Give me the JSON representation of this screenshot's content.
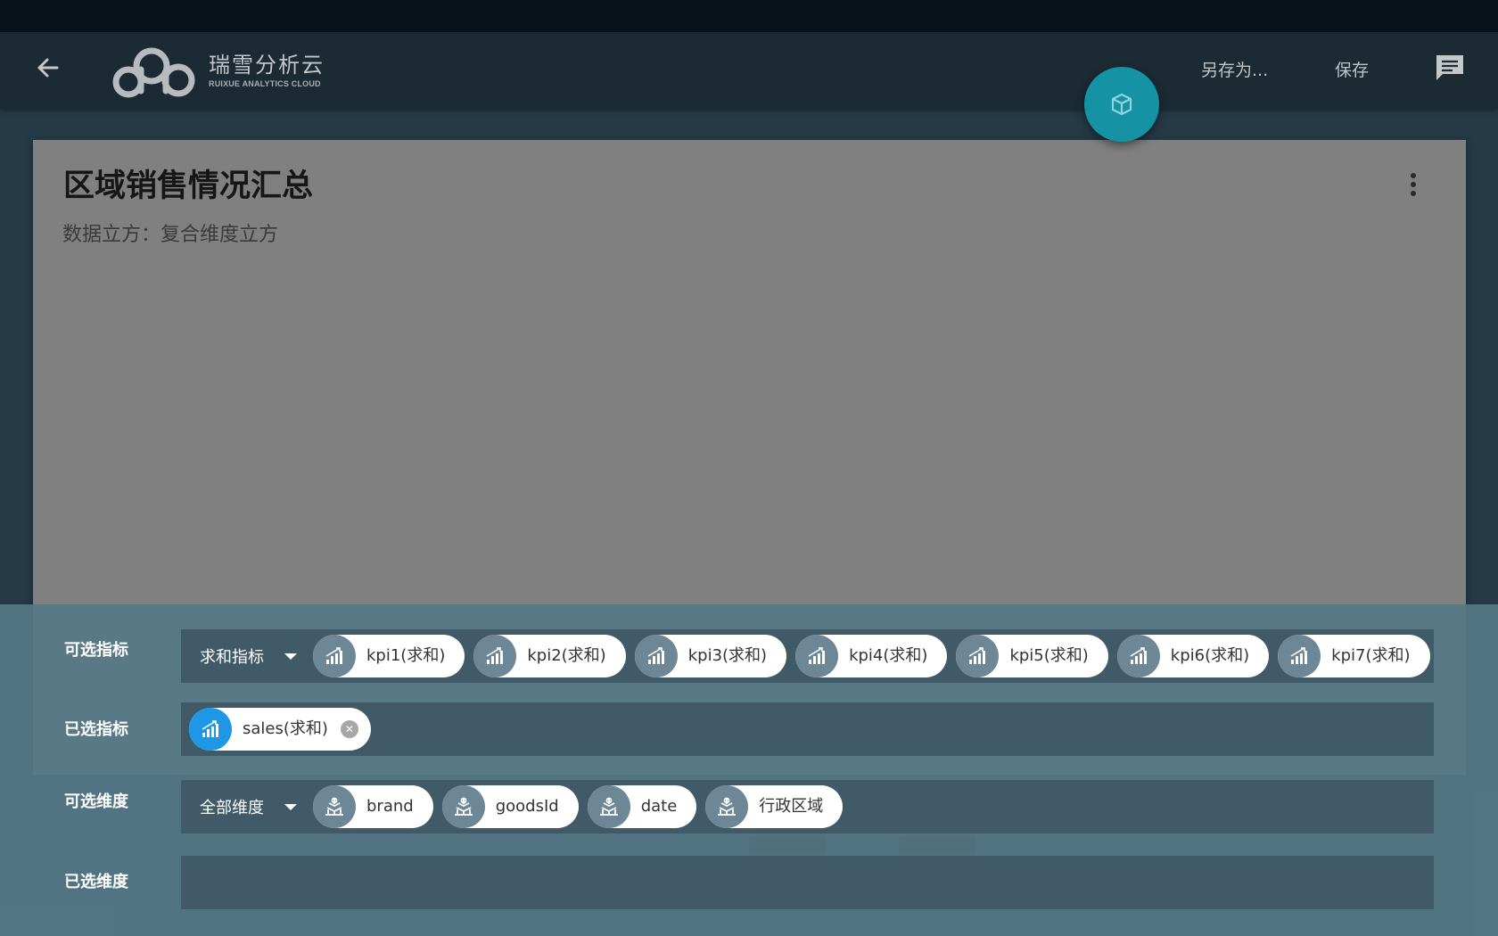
{
  "colors": {
    "topbar": "#1c2a34",
    "card": "#808080",
    "fab": "#1692a5",
    "panel": "#567886",
    "row_box": "#415a68",
    "chip_icon": "#6e8796",
    "chip_icon_selected": "#1e98e6"
  },
  "header": {
    "back_icon": "arrow-left-icon",
    "logo_cn": "瑞雪分析云",
    "logo_en": "RUIXUE ANALYTICS CLOUD",
    "save_as_label": "另存为...",
    "save_label": "保存",
    "comment_icon": "comment-icon"
  },
  "fab": {
    "icon": "cube-icon"
  },
  "card": {
    "title": "区域销售情况汇总",
    "subtitle": "数据立方：复合维度立方",
    "menu_icon": "more-vertical-icon"
  },
  "panel": {
    "available_metrics": {
      "label": "可选指标",
      "dropdown": "求和指标",
      "chips": [
        "kpi1(求和)",
        "kpi2(求和)",
        "kpi3(求和)",
        "kpi4(求和)",
        "kpi5(求和)",
        "kpi6(求和)",
        "kpi7(求和)"
      ]
    },
    "selected_metrics": {
      "label": "已选指标",
      "chips": [
        "sales(求和)"
      ]
    },
    "available_dimensions": {
      "label": "可选维度",
      "dropdown": "全部维度",
      "chips": [
        "brand",
        "goodsId",
        "date",
        "行政区域"
      ]
    },
    "selected_dimensions": {
      "label": "已选维度",
      "chips": []
    }
  }
}
